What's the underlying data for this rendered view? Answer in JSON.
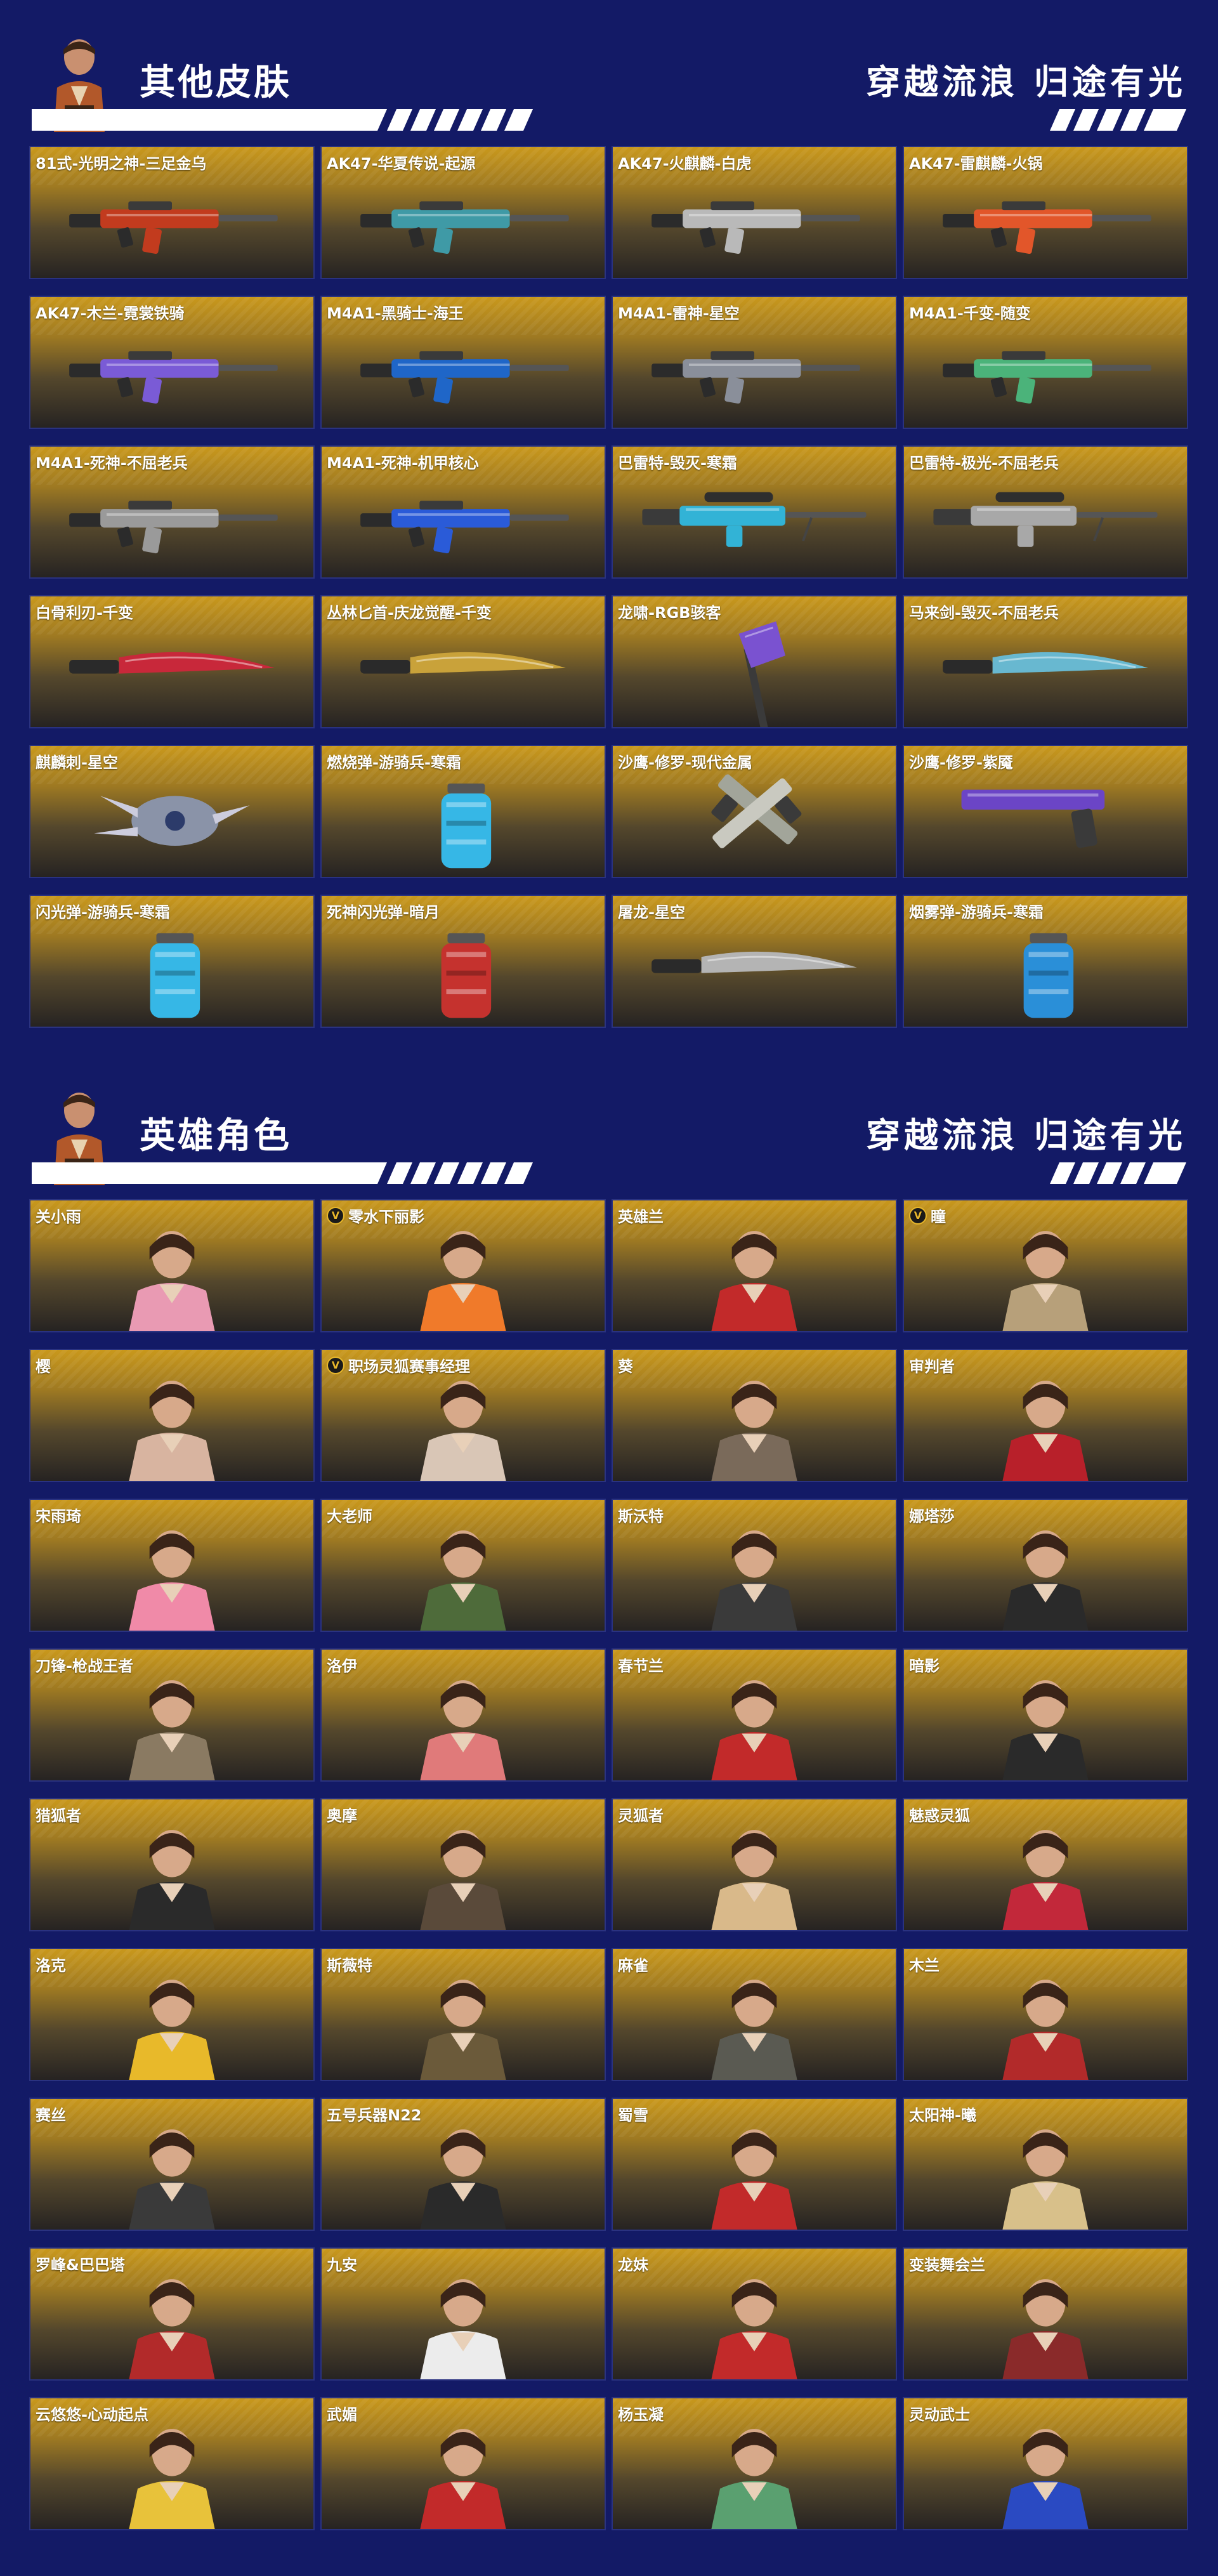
{
  "sections": [
    {
      "title": "其他皮肤",
      "slogan": "穿越流浪 归途有光",
      "items": [
        {
          "label": "81式-光明之神-三足金乌",
          "art": "rifle",
          "color": "#c23b1e",
          "badge": false
        },
        {
          "label": "AK47-华夏传说-起源",
          "art": "rifle",
          "color": "#3f9aa6",
          "badge": false
        },
        {
          "label": "AK47-火麒麟-白虎",
          "art": "rifle",
          "color": "#b9b9b9",
          "badge": false
        },
        {
          "label": "AK47-雷麒麟-火锅",
          "art": "rifle",
          "color": "#e2562a",
          "badge": false
        },
        {
          "label": "AK47-木兰-霓裳铁骑",
          "art": "rifle",
          "color": "#7a5bd6",
          "badge": false
        },
        {
          "label": "M4A1-黑骑士-海王",
          "art": "rifle",
          "color": "#1f66c8",
          "badge": false
        },
        {
          "label": "M4A1-雷神-星空",
          "art": "rifle",
          "color": "#8a8f9a",
          "badge": false
        },
        {
          "label": "M4A1-千变-随变",
          "art": "rifle",
          "color": "#4bb37a",
          "badge": false
        },
        {
          "label": "M4A1-死神-不屈老兵",
          "art": "rifle",
          "color": "#9a9a9a",
          "badge": false
        },
        {
          "label": "M4A1-死神-机甲核心",
          "art": "rifle",
          "color": "#2a5bd8",
          "badge": false
        },
        {
          "label": "巴雷特-毁灭-寒霜",
          "art": "sniper",
          "color": "#32b3d6",
          "badge": false
        },
        {
          "label": "巴雷特-极光-不屈老兵",
          "art": "sniper",
          "color": "#a8a8a8",
          "badge": false
        },
        {
          "label": "白骨利刃-千变",
          "art": "blade",
          "color": "#c8283a",
          "badge": false
        },
        {
          "label": "丛林匕首-庆龙觉醒-千变",
          "art": "blade",
          "color": "#c9a23a",
          "badge": false
        },
        {
          "label": "龙啸-RGB骇客",
          "art": "axe",
          "color": "#7a52d0",
          "badge": false
        },
        {
          "label": "马来剑-毁灭-不屈老兵",
          "art": "blade",
          "color": "#68b8d0",
          "badge": false
        },
        {
          "label": "麒麟刺-星空",
          "art": "claw",
          "color": "#8a93a8",
          "badge": false
        },
        {
          "label": "燃烧弹-游骑兵-寒霜",
          "art": "grenade",
          "color": "#36b7e6",
          "badge": false
        },
        {
          "label": "沙鹰-修罗-现代金属",
          "art": "pistols",
          "color": "#a2a59a",
          "badge": false
        },
        {
          "label": "沙鹰-修罗-紫魇",
          "art": "pistol",
          "color": "#6b45c6",
          "badge": false
        },
        {
          "label": "闪光弹-游骑兵-寒霜",
          "art": "grenade",
          "color": "#36b7e6",
          "badge": false
        },
        {
          "label": "死神闪光弹-暗月",
          "art": "grenade",
          "color": "#c5322e",
          "badge": false
        },
        {
          "label": "屠龙-星空",
          "art": "blade",
          "color": "#b4b4b4",
          "badge": false
        },
        {
          "label": "烟雾弹-游骑兵-寒霜",
          "art": "grenade",
          "color": "#2a8fd8",
          "badge": false
        }
      ]
    },
    {
      "title": "英雄角色",
      "slogan": "穿越流浪 归途有光",
      "items": [
        {
          "label": "关小雨",
          "art": "character",
          "color": "#e99ab3",
          "badge": false
        },
        {
          "label": "零水下丽影",
          "art": "character",
          "color": "#f07a2a",
          "badge": true
        },
        {
          "label": "英雄兰",
          "art": "character",
          "color": "#c22a2a",
          "badge": false
        },
        {
          "label": "瞳",
          "art": "character",
          "color": "#b7a07a",
          "badge": true
        },
        {
          "label": "樱",
          "art": "character",
          "color": "#d8b4a0",
          "badge": false
        },
        {
          "label": "职场灵狐赛事经理",
          "art": "character",
          "color": "#d9c6b6",
          "badge": true
        },
        {
          "label": "葵",
          "art": "character",
          "color": "#7a6a5a",
          "badge": false
        },
        {
          "label": "审判者",
          "art": "character",
          "color": "#b8202a",
          "badge": false
        },
        {
          "label": "宋雨琦",
          "art": "character",
          "color": "#f08aa8",
          "badge": false
        },
        {
          "label": "大老师",
          "art": "character",
          "color": "#4e6b3a",
          "badge": false
        },
        {
          "label": "斯沃特",
          "art": "character",
          "color": "#3a3a3a",
          "badge": false
        },
        {
          "label": "娜塔莎",
          "art": "character",
          "color": "#2a2a2a",
          "badge": false
        },
        {
          "label": "刀锋-枪战王者",
          "art": "character",
          "color": "#8a7a62",
          "badge": false
        },
        {
          "label": "洛伊",
          "art": "character",
          "color": "#e07a7a",
          "badge": false
        },
        {
          "label": "春节兰",
          "art": "character",
          "color": "#c22a2a",
          "badge": false
        },
        {
          "label": "暗影",
          "art": "character",
          "color": "#2a2a2a",
          "badge": false
        },
        {
          "label": "猎狐者",
          "art": "character",
          "color": "#2a2a2a",
          "badge": false
        },
        {
          "label": "奥摩",
          "art": "character",
          "color": "#5a4a3a",
          "badge": false
        },
        {
          "label": "灵狐者",
          "art": "character",
          "color": "#d9b98a",
          "badge": false
        },
        {
          "label": "魅惑灵狐",
          "art": "character",
          "color": "#c2283a",
          "badge": false
        },
        {
          "label": "洛克",
          "art": "character",
          "color": "#e8b92a",
          "badge": false
        },
        {
          "label": "斯薇特",
          "art": "character",
          "color": "#6b5a3a",
          "badge": false
        },
        {
          "label": "麻雀",
          "art": "character",
          "color": "#5a5a52",
          "badge": false
        },
        {
          "label": "木兰",
          "art": "character",
          "color": "#b22a2a",
          "badge": false
        },
        {
          "label": "赛丝",
          "art": "character",
          "color": "#3a3a3a",
          "badge": false
        },
        {
          "label": "五号兵器N22",
          "art": "character",
          "color": "#2a2a2a",
          "badge": false
        },
        {
          "label": "蜀雪",
          "art": "character",
          "color": "#c22a2a",
          "badge": false
        },
        {
          "label": "太阳神-曦",
          "art": "character",
          "color": "#d8c08a",
          "badge": false
        },
        {
          "label": "罗峰&巴巴塔",
          "art": "character",
          "color": "#b22a2a",
          "badge": false
        },
        {
          "label": "九安",
          "art": "character",
          "color": "#ececec",
          "badge": false
        },
        {
          "label": "龙妹",
          "art": "character",
          "color": "#c22a2a",
          "badge": false
        },
        {
          "label": "变装舞会兰",
          "art": "character",
          "color": "#8a2a2a",
          "badge": false
        },
        {
          "label": "云悠悠-心动起点",
          "art": "character",
          "color": "#e8c23a",
          "badge": false
        },
        {
          "label": "武媚",
          "art": "character",
          "color": "#c22a2a",
          "badge": false
        },
        {
          "label": "杨玉凝",
          "art": "character",
          "color": "#5aa070",
          "badge": false
        },
        {
          "label": "灵动武士",
          "art": "character",
          "color": "#2a4ac2",
          "badge": false
        }
      ]
    }
  ]
}
